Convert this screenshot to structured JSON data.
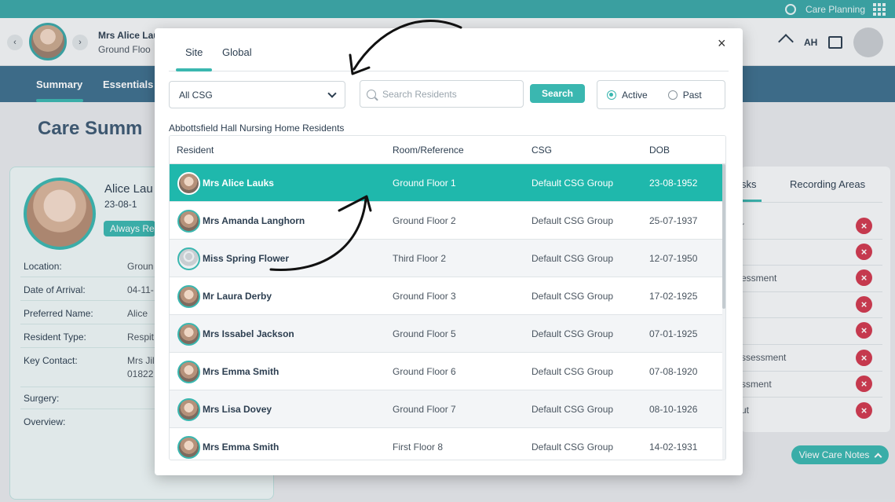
{
  "topbar": {
    "app_label": "Care Planning"
  },
  "header": {
    "resident_name": "Mrs Alice Lau",
    "resident_floor": "Ground Floo",
    "prev_icon": "‹",
    "next_icon": "›",
    "user_initials": "AH"
  },
  "menu": {
    "items": [
      "Summary",
      "Essentials"
    ]
  },
  "page": {
    "title": "Care Summ"
  },
  "left_card": {
    "name": "Alice Lau",
    "dob": "23-08-1",
    "badge": "Always Re",
    "fields": [
      {
        "label": "Location:",
        "value": "Groun"
      },
      {
        "label": "Date of Arrival:",
        "value": "04-11-"
      },
      {
        "label": "Preferred Name:",
        "value": "Alice"
      },
      {
        "label": "Resident Type:",
        "value": "Respit"
      },
      {
        "label": "Key Contact:",
        "value": "Mrs Jil",
        "value2": "01822"
      },
      {
        "label": "Surgery:",
        "value": ""
      },
      {
        "label": "Overview:",
        "value": ""
      }
    ]
  },
  "right_card": {
    "tabs": [
      "sks",
      "Recording Areas"
    ],
    "items": [
      "r",
      "",
      "essment",
      "",
      "",
      "ssessment",
      "ssment",
      "ut"
    ],
    "care_notes_label": "View Care Notes"
  },
  "modal": {
    "tabs": [
      "Site",
      "Global"
    ],
    "active_tab": "Site",
    "close_label": "×",
    "csg_select": {
      "value": "All CSG"
    },
    "search": {
      "placeholder": "Search Residents",
      "value": "",
      "button_label": "Search"
    },
    "status_filter": {
      "options": [
        "Active",
        "Past"
      ],
      "selected": "Active"
    },
    "table_title": "Abbottsfield Hall Nursing Home Residents",
    "columns": [
      "Resident",
      "Room/Reference",
      "CSG",
      "DOB"
    ],
    "rows": [
      {
        "name": "Mrs Alice Lauks",
        "room": "Ground Floor 1",
        "csg": "Default CSG Group",
        "dob": "23-08-1952",
        "selected": true
      },
      {
        "name": "Mrs Amanda Langhorn",
        "room": "Ground Floor 2",
        "csg": "Default CSG Group",
        "dob": "25-07-1937"
      },
      {
        "name": "Miss Spring Flower",
        "room": "Third Floor 2",
        "csg": "Default CSG Group",
        "dob": "12-07-1950",
        "no_photo": true
      },
      {
        "name": "Mr Laura Derby",
        "room": "Ground Floor 3",
        "csg": "Default CSG Group",
        "dob": "17-02-1925"
      },
      {
        "name": "Mrs Issabel Jackson",
        "room": "Ground Floor 5",
        "csg": "Default CSG Group",
        "dob": "07-01-1925"
      },
      {
        "name": "Mrs Emma Smith",
        "room": "Ground Floor 6",
        "csg": "Default CSG Group",
        "dob": "07-08-1920"
      },
      {
        "name": "Mrs Lisa Dovey",
        "room": "Ground Floor 7",
        "csg": "Default CSG Group",
        "dob": "08-10-1926"
      },
      {
        "name": "Mrs Emma Smith",
        "room": "First Floor 8",
        "csg": "Default CSG Group",
        "dob": "14-02-1931"
      }
    ]
  },
  "colors": {
    "accent": "#3ab7b0",
    "selected_row": "#1fb8ac",
    "menubar": "#3d6f8e",
    "danger": "#d1394f"
  }
}
